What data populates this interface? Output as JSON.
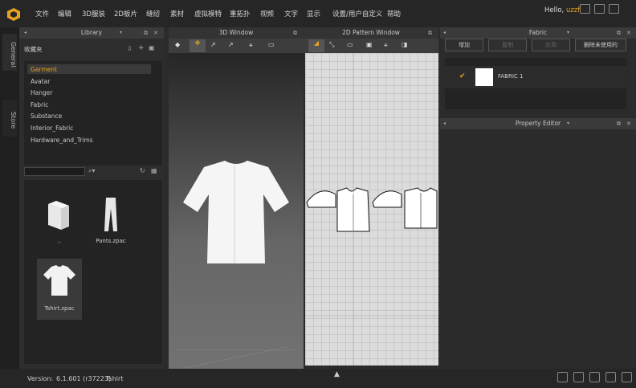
{
  "menu": [
    "文件",
    "编辑",
    "3D服装",
    "2D板片",
    "缝纫",
    "素材",
    "虚拟模特",
    "重拓扑",
    "视频",
    "文字",
    "显示",
    "设置/用户自定义",
    "帮助"
  ],
  "user": {
    "greeting": "Hello,",
    "name": "uzzf"
  },
  "side_tabs": [
    "General",
    "Store"
  ],
  "library": {
    "title": "Library",
    "favorites_label": "收藏夹",
    "items": [
      "Garment",
      "Avatar",
      "Hanger",
      "Fabric",
      "Substance",
      "Interior_Fabric",
      "Hardware_and_Trims"
    ],
    "selected": "Garment",
    "search_placeholder": "",
    "files": [
      {
        "name": "..",
        "icon": "folder-icon"
      },
      {
        "name": "Pants.zpac",
        "icon": "pants-icon"
      },
      {
        "name": "Tshirt.zpac",
        "icon": "tshirt-icon"
      }
    ]
  },
  "window3d": {
    "title": "3D Window"
  },
  "window2d": {
    "title": "2D Pattern Window"
  },
  "fabric": {
    "title": "Fabric",
    "buttons": [
      "增加",
      "复制",
      "应用",
      "删除未使用的"
    ],
    "items": [
      {
        "name": "FABRIC 1",
        "checked": true
      }
    ]
  },
  "property_editor": {
    "title": "Property Editor"
  },
  "status": {
    "version_label": "Version:",
    "version": "6.1.601 (r37223)",
    "file": "Tshirt"
  },
  "colors": {
    "accent": "#e8a21f",
    "panel_bg": "#2d2d2d",
    "grid_bg": "#dcdcdc"
  }
}
